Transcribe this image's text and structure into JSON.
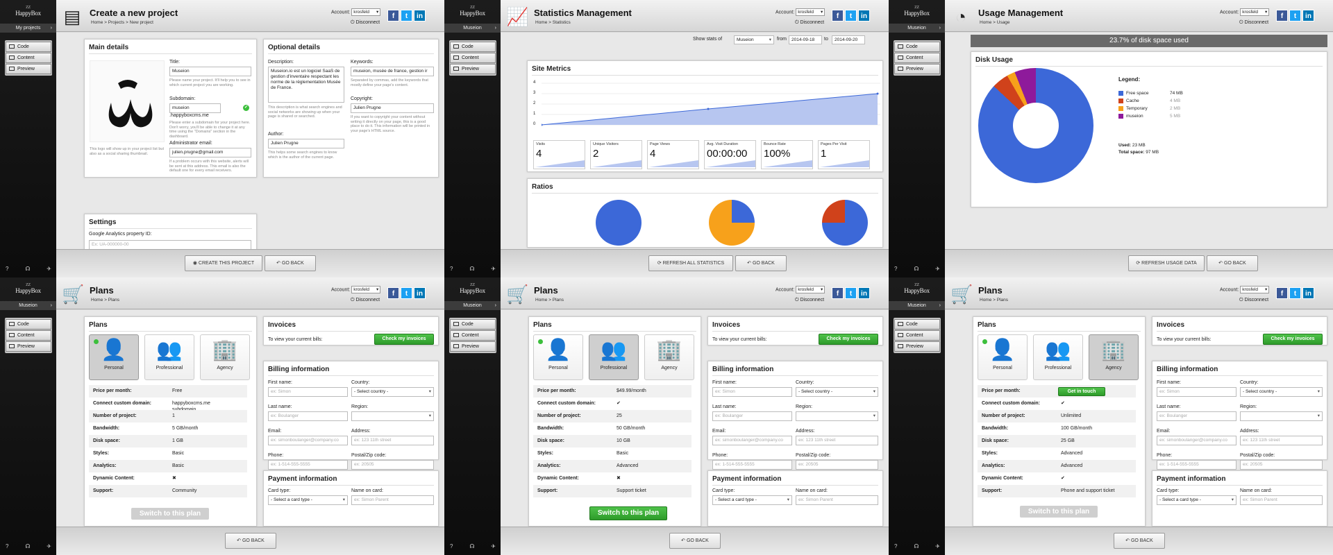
{
  "common": {
    "logo": "HappyBox",
    "logo_small": "ZZ",
    "account_label": "Account:",
    "account_value": "krosfeld",
    "disconnect": "Disconnect",
    "menu": [
      "Code",
      "Content",
      "Preview"
    ],
    "go_back": "GO BACK",
    "social": {
      "fb": "f",
      "tw": "t",
      "li": "in"
    },
    "footer_icons": [
      "?",
      "☊",
      "✈"
    ],
    "colors": {
      "green": "#2e9b2a",
      "blue": "#3c68d8",
      "orange": "#f7a11b",
      "red": "#d0421b",
      "purple": "#8e1a9b"
    }
  },
  "p1": {
    "project_selector": "My projects",
    "title": "Create a new project",
    "breadcrumb": "Home > Projects > New project",
    "main_title": "Main details",
    "title_label": "Title:",
    "title_value": "Museion",
    "title_help": "Please name your project. It'll help you to see in which current project you are working.",
    "subdomain_label": "Subdomain:",
    "subdomain_value": "museion",
    "subdomain_suffix": ".happyboxcms.me",
    "subdomain_help": "Please enter a subdomain for your project here. Don't worry, you'll be able to change it at any time using the \"Domains\" section in the dashboard.",
    "email_label": "Administrator email:",
    "email_value": "julien.prugne@gmail.com",
    "email_help": "If a problem occurs with this website, alerts will be sent at this address. This email is also the default one for every email receivers.",
    "logo_help": "This logo will show up in your project list but also as a social sharing thumbnail.",
    "optional_title": "Optional details",
    "desc_label": "Description:",
    "desc_value": "Museion.io est un logiciel SaaS de gestion d'inventaire respectant les norme de la réglementation Musée de France.",
    "desc_help": "This description is what search engines and social networks are showing up when your page is shared or searched.",
    "keywords_label": "Keywords:",
    "keywords_value": "museion, musée de france, gestion ir",
    "keywords_help": "Separated by commas, add the keywords that mostly define your page's content.",
    "copyright_label": "Copyright:",
    "copyright_value": "Julien Prugne",
    "copyright_help": "If you want to copyright your content without writing it directly on your page, this is a good place to do it. This information will be printed in your page's HTML source.",
    "author_label": "Author:",
    "author_value": "Julien Prugne",
    "author_help": "This helps some search engines to know which is the author of the current page.",
    "settings_title": "Settings",
    "ga_label": "Google Analytics property ID:",
    "ga_placeholder": "Ex: UA-000000-00",
    "create_btn": "CREATE THIS PROJECT"
  },
  "p2": {
    "project_selector": "Museion",
    "title": "Statistics Management",
    "breadcrumb": "Home > Statistics",
    "show_stats_of": "Show stats of",
    "site_value": "Museion",
    "from": "from",
    "from_date": "2014-09-18",
    "to": "to",
    "to_date": "2014-09-20",
    "site_metrics": "Site Metrics",
    "y_ticks": [
      "4",
      "3",
      "2",
      "1",
      "0"
    ],
    "metrics": [
      {
        "label": "Visits",
        "value": "4"
      },
      {
        "label": "Unique Visitors",
        "value": "2"
      },
      {
        "label": "Page Views",
        "value": "4"
      },
      {
        "label": "Avg. Visit Duration",
        "value": "00:00:00"
      },
      {
        "label": "Bounce Rate",
        "value": "100%"
      },
      {
        "label": "Pages Per Visit",
        "value": "1"
      }
    ],
    "ratios": "Ratios",
    "refresh_btn": "REFRESH ALL STATISTICS"
  },
  "p3": {
    "project_selector": "Museion",
    "title": "Usage Management",
    "breadcrumb": "Home > Usage",
    "banner": "23.7% of disk space used",
    "disk_usage": "Disk Usage",
    "legend_title": "Legend:",
    "legend": [
      {
        "name": "Free space",
        "value": "74 MB",
        "color": "#3c68d8"
      },
      {
        "name": "Cache",
        "value": "4 MB",
        "color": "#d0421b"
      },
      {
        "name": "Temporary",
        "value": "2 MB",
        "color": "#f7a11b"
      },
      {
        "name": "museion",
        "value": "5 MB",
        "color": "#8e1a9b"
      }
    ],
    "used_label": "Used:",
    "used_value": "23 MB",
    "total_label": "Total space:",
    "total_value": "97 MB",
    "refresh_btn": "REFRESH USAGE DATA"
  },
  "plans_common": {
    "project_selector": "Museion",
    "title": "Plans",
    "breadcrumb": "Home > Plans",
    "plans_title": "Plans",
    "plan_names": [
      "Personal",
      "Professional",
      "Agency"
    ],
    "feature_keys": [
      "Price per month:",
      "Connect custom domain:",
      "Number of project:",
      "Bandwidth:",
      "Disk space:",
      "Styles:",
      "Analytics:",
      "Dynamic Content:",
      "Support:"
    ],
    "invoices_title": "Invoices",
    "invoices_text": "To view your current bills:",
    "invoices_btn": "Check my invoices",
    "billing_title": "Billing information",
    "first_name": "First name:",
    "first_ph": "ex: Simon",
    "country": "Country:",
    "country_sel": "- Select country -",
    "last_name": "Last name:",
    "last_ph": "ex: Boulanger",
    "region": "Region:",
    "email": "Email:",
    "email_ph": "ex: simonboulanger@company.co",
    "address": "Address:",
    "address_ph": "ex: 123 11th street",
    "phone": "Phone:",
    "phone_ph": "ex: 1-514-555-5555",
    "zip": "Postal/Zip code:",
    "zip_ph": "ex: 20505",
    "payment_title": "Payment information",
    "card_type": "Card type:",
    "card_sel": "- Select a card type -",
    "name_on_card": "Name on card:",
    "name_ph": "ex: Simon Parent",
    "switch_btn": "Switch to this plan"
  },
  "p4": {
    "values": [
      "Free",
      "happyboxcms.me subdomain",
      "1",
      "5 GB/month",
      "1 GB",
      "Basic",
      "Basic",
      "✖",
      "Community"
    ]
  },
  "p5": {
    "values": [
      "$49.99/month",
      "✔",
      "25",
      "50 GB/month",
      "10 GB",
      "Basic",
      "Advanced",
      "✖",
      "Support ticket"
    ]
  },
  "p6": {
    "get_in_touch": "Get in touch",
    "values": [
      "",
      "✔",
      "Unlimited",
      "100 GB/month",
      "25 GB",
      "Advanced",
      "Advanced",
      "✔",
      "Phone and support ticket"
    ]
  }
}
